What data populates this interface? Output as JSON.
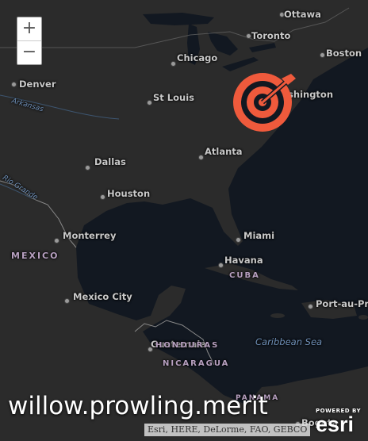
{
  "map": {
    "zoom_in_label": "+",
    "zoom_out_label": "−",
    "cities": {
      "ottawa": "Ottawa",
      "toronto": "Toronto",
      "boston": "Boston",
      "chicago": "Chicago",
      "denver": "Denver",
      "st_louis": "St Louis",
      "washington": "Washington",
      "atlanta": "Atlanta",
      "dallas": "Dallas",
      "houston": "Houston",
      "miami": "Miami",
      "monterrey": "Monterrey",
      "havana": "Havana",
      "mexico_city": "Mexico City",
      "port_au_prince": "Port-au-Pr",
      "guatemala": "Guatemala",
      "bogota": "Bogota"
    },
    "countries": {
      "mexico": "MEXICO",
      "cuba": "CUBA",
      "honduras": "HONDURAS",
      "nicaragua": "NICARAGUA",
      "panama": "PANAMA"
    },
    "water": {
      "arkansas": "Arkansas",
      "rio_grande": "Rio Grande",
      "caribbean_sea": "Caribbean Sea"
    },
    "marker": {
      "icon": "target-icon",
      "color": "#ef5a3c"
    }
  },
  "watermark": "willow.prowling.merit",
  "attribution": "Esri, HERE, DeLorme, FAO, GEBCO",
  "logo": {
    "powered_by": "POWERED BY",
    "wordmark": "esri"
  }
}
